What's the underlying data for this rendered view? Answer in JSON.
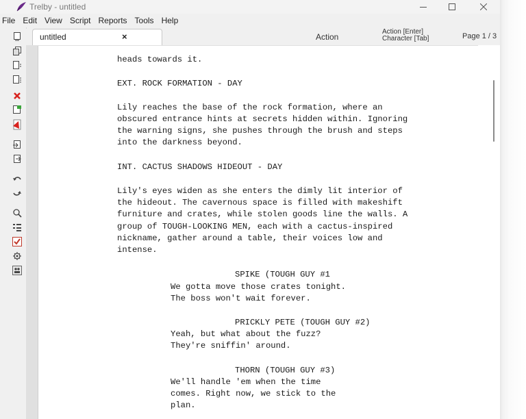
{
  "window": {
    "title": "Trelby - untitled",
    "app_icon": "trelby-quill-icon",
    "accent_color": "#6b2b8a"
  },
  "menu": [
    "File",
    "Edit",
    "View",
    "Script",
    "Reports",
    "Tools",
    "Help"
  ],
  "toolbar": [
    {
      "name": "new-script-icon"
    },
    {
      "name": "open-script-icon"
    },
    {
      "name": "save-script-icon"
    },
    {
      "name": "save-as-icon"
    },
    {
      "name": "close-script-icon"
    },
    {
      "name": "import-icon"
    },
    {
      "name": "pdf-export-icon"
    },
    {
      "name": "export-icon"
    },
    {
      "name": "revert-icon"
    },
    {
      "name": "undo-icon"
    },
    {
      "name": "redo-icon"
    },
    {
      "name": "find-icon"
    },
    {
      "name": "element-types-icon"
    },
    {
      "name": "spell-check-icon"
    },
    {
      "name": "settings-icon"
    },
    {
      "name": "characters-icon"
    }
  ],
  "tab": {
    "label": "untitled",
    "close": "×"
  },
  "status": {
    "element": "Action",
    "key_line1": "Action [Enter]",
    "key_line2": "Character [Tab]",
    "page": "Page 1 / 3"
  },
  "script_lines": [
    {
      "type": "action",
      "text": "heads towards it."
    },
    {
      "type": "scene",
      "text": "EXT. ROCK FORMATION - DAY"
    },
    {
      "type": "action",
      "text": "Lily reaches the base of the rock formation, where an"
    },
    {
      "type": "action",
      "text": "obscured entrance hints at secrets hidden within. Ignoring"
    },
    {
      "type": "action",
      "text": "the warning signs, she pushes through the brush and steps"
    },
    {
      "type": "action",
      "text": "into the darkness beyond."
    },
    {
      "type": "scene",
      "text": "INT. CACTUS SHADOWS HIDEOUT - DAY"
    },
    {
      "type": "action",
      "text": "Lily's eyes widen as she enters the dimly lit interior of"
    },
    {
      "type": "action",
      "text": "the hideout. The cavernous space is filled with makeshift"
    },
    {
      "type": "action",
      "text": "furniture and crates, while stolen goods line the walls. A"
    },
    {
      "type": "action",
      "text": "group of TOUGH-LOOKING MEN, each with a cactus-inspired"
    },
    {
      "type": "action",
      "text": "nickname, gather around a table, their voices low and"
    },
    {
      "type": "action",
      "text": "intense."
    },
    {
      "type": "character",
      "text": "SPIKE (TOUGH GUY #1"
    },
    {
      "type": "dialogue",
      "text": "We gotta move those crates tonight."
    },
    {
      "type": "dialogue",
      "text": "The boss won't wait forever."
    },
    {
      "type": "character",
      "text": "PRICKLY PETE (TOUGH GUY #2)"
    },
    {
      "type": "dialogue",
      "text": "Yeah, but what about the fuzz?"
    },
    {
      "type": "dialogue",
      "text": "They're sniffin' around."
    },
    {
      "type": "character",
      "text": "THORN (TOUGH GUY #3)"
    },
    {
      "type": "dialogue",
      "text": "We'll handle 'em when the time"
    },
    {
      "type": "dialogue",
      "text": "comes. Right now, we stick to the"
    },
    {
      "type": "dialogue",
      "text": "plan."
    }
  ]
}
